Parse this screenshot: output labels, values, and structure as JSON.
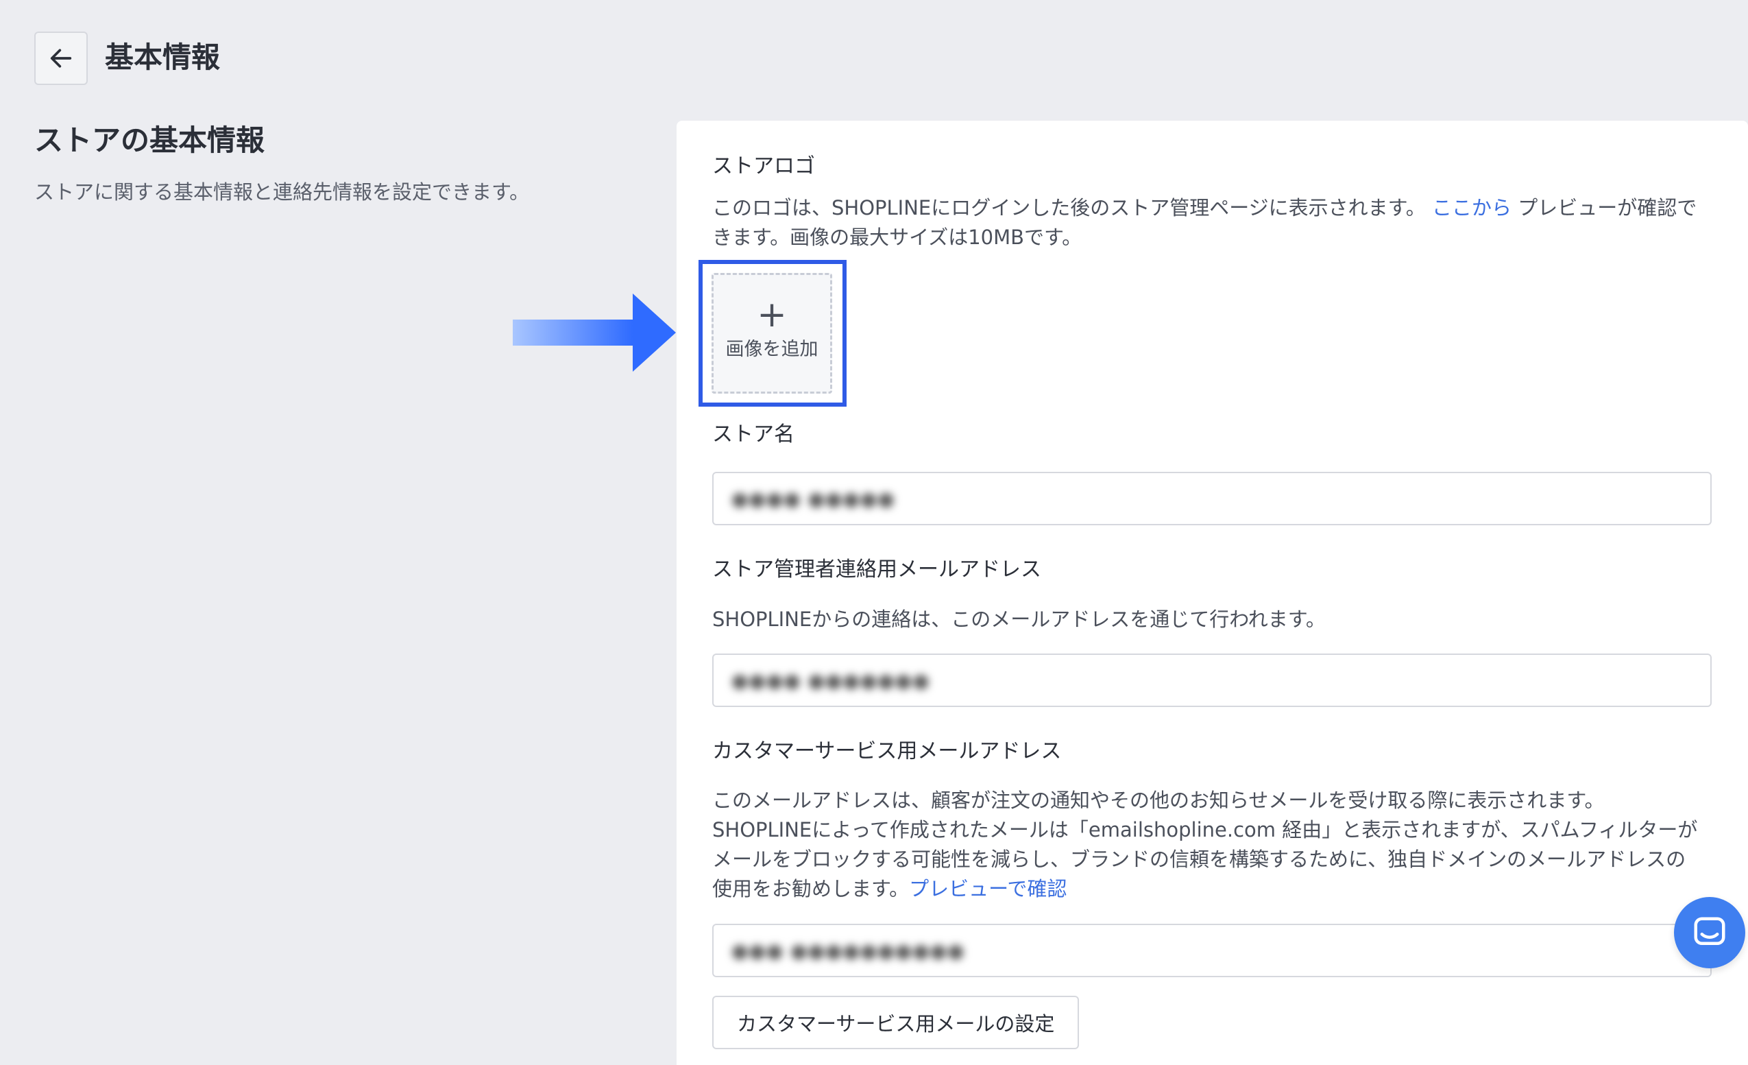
{
  "header": {
    "title": "基本情報"
  },
  "left": {
    "section_title": "ストアの基本情報",
    "section_desc": "ストアに関する基本情報と連絡先情報を設定できます。"
  },
  "logo": {
    "label": "ストアロゴ",
    "desc_before_link": "このロゴは、SHOPLINEにログインした後のストア管理ページに表示されます。 ",
    "desc_link": "ここから",
    "desc_after_link": " プレビューが確認できます。画像の最大サイズは10MBです。",
    "upload_plus": "+",
    "upload_label": "画像を追加"
  },
  "store_name": {
    "label": "ストア名",
    "value": "●●●● ●●●●●"
  },
  "admin_email": {
    "label": "ストア管理者連絡用メールアドレス",
    "desc": "SHOPLINEからの連絡は、このメールアドレスを通じて行われます。",
    "value": "●●●● ●●●●●●●"
  },
  "cs_email": {
    "label": "カスタマーサービス用メールアドレス",
    "desc": "このメールアドレスは、顧客が注文の通知やその他のお知らせメールを受け取る際に表示されます。SHOPLINEによって作成されたメールは「emailshopline.com 経由」と表示されますが、スパムフィルターがメールをブロックする可能性を減らし、ブランドの信頼を構築するために、独自ドメインのメールアドレスの使用をお勧めします。",
    "desc_link": "プレビューで確認",
    "value": "●●● ●●●●●●●●●●",
    "button_label": "カスタマーサービス用メールの設定"
  },
  "colors": {
    "accent": "#3b6fe0",
    "highlight": "#2f5be6",
    "chat": "#3f7ff0",
    "background": "#ecedf1"
  }
}
